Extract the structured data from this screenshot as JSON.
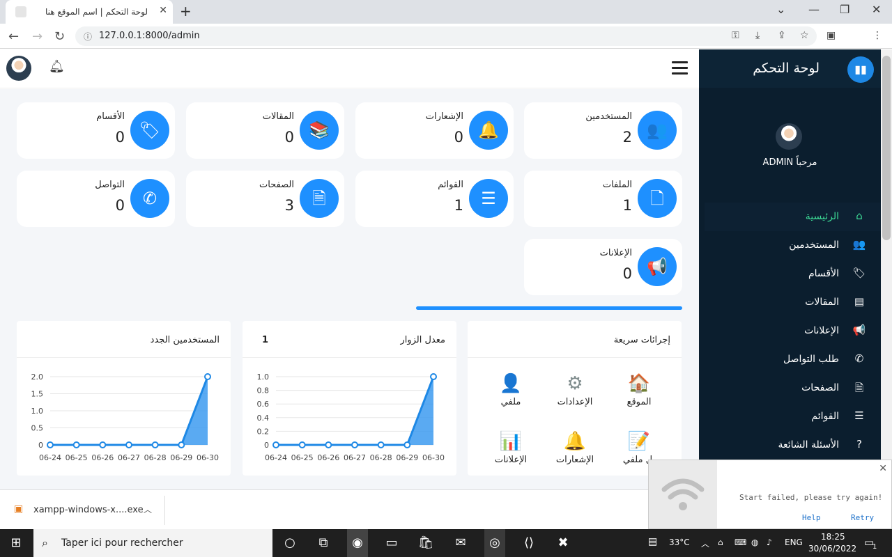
{
  "browser": {
    "tab_title": "لوحة التحكم | اسم الموقع هنا",
    "url": "127.0.0.1:8000/admin"
  },
  "sidebar": {
    "title": "لوحة التحكم",
    "welcome": "مرحباً ADMIN",
    "items": [
      {
        "label": "الرئيسية",
        "icon": "home-icon",
        "glyph": "⌂"
      },
      {
        "label": "المستخدمين",
        "icon": "users-icon",
        "glyph": "👥"
      },
      {
        "label": "الأقسام",
        "icon": "tag-icon",
        "glyph": "🏷"
      },
      {
        "label": "المقالات",
        "icon": "newspaper-icon",
        "glyph": "▤"
      },
      {
        "label": "الإعلانات",
        "icon": "megaphone-icon",
        "glyph": "📢"
      },
      {
        "label": "طلب التواصل",
        "icon": "phone-icon",
        "glyph": "✆"
      },
      {
        "label": "الصفحات",
        "icon": "page-icon",
        "glyph": "🗎"
      },
      {
        "label": "القوائم",
        "icon": "list-icon",
        "glyph": "☰"
      },
      {
        "label": "الأسئلة الشائعة",
        "icon": "question-icon",
        "glyph": "?"
      }
    ]
  },
  "cards": [
    {
      "label": "المستخدمين",
      "value": "2",
      "icon": "users-icon",
      "glyph": "👥"
    },
    {
      "label": "الإشعارات",
      "value": "0",
      "icon": "bell-icon",
      "glyph": "🔔"
    },
    {
      "label": "المقالات",
      "value": "0",
      "icon": "books-icon",
      "glyph": "📚"
    },
    {
      "label": "الأقسام",
      "value": "0",
      "icon": "tag-icon",
      "glyph": "🏷"
    },
    {
      "label": "الملفات",
      "value": "1",
      "icon": "file-icon",
      "glyph": "🗋"
    },
    {
      "label": "القوائم",
      "value": "1",
      "icon": "list-icon",
      "glyph": "☰"
    },
    {
      "label": "الصفحات",
      "value": "3",
      "icon": "page-icon",
      "glyph": "🗎"
    },
    {
      "label": "التواصل",
      "value": "0",
      "icon": "phone-icon",
      "glyph": "✆"
    },
    {
      "label": "الإعلانات",
      "value": "0",
      "icon": "megaphone-icon",
      "glyph": "📢"
    }
  ],
  "quick_actions": {
    "title": "إجرائات سريعة",
    "items": [
      {
        "label": "الموقع",
        "icon": "house-icon",
        "glyph": "🏠"
      },
      {
        "label": "الإعدادات",
        "icon": "gears-icon",
        "glyph": "⚙"
      },
      {
        "label": "ملفي",
        "icon": "profile-icon",
        "glyph": "👤"
      },
      {
        "label": "يل ملفي",
        "icon": "edit-profile-icon",
        "glyph": "📝"
      },
      {
        "label": "الإشعارات",
        "icon": "bell-icon",
        "glyph": "🔔"
      },
      {
        "label": "الإعلانات",
        "icon": "ads-icon",
        "glyph": "📊"
      }
    ]
  },
  "chart_data": [
    {
      "type": "area",
      "title": "معدل الزوار",
      "badge": "1",
      "categories": [
        "06-24",
        "06-25",
        "06-26",
        "06-27",
        "06-28",
        "06-29",
        "06-30"
      ],
      "values": [
        0,
        0,
        0,
        0,
        0,
        0,
        1
      ],
      "ylim": [
        0,
        1
      ],
      "yticks": [
        "1.0",
        "0.8",
        "0.6",
        "0.4",
        "0.2",
        "0"
      ],
      "color": "#3d9bf0"
    },
    {
      "type": "area",
      "title": "المستخدمين الجدد",
      "categories": [
        "06-24",
        "06-25",
        "06-26",
        "06-27",
        "06-28",
        "06-29",
        "06-30"
      ],
      "values": [
        0,
        0,
        0,
        0,
        0,
        0,
        2
      ],
      "ylim": [
        0,
        2
      ],
      "yticks": [
        "2.0",
        "1.5",
        "1.0",
        "0.5",
        "0"
      ],
      "color": "#3d9bf0"
    }
  ],
  "download": {
    "file": "xampp-windows-x....exe"
  },
  "popup": {
    "message": "Start failed, please try again!",
    "help": "Help",
    "retry": "Retry"
  },
  "taskbar": {
    "search": "Taper ici pour rechercher",
    "temp": "33°C",
    "lang": "ENG",
    "time": "18:25",
    "date": "30/06/2022",
    "notif": "1"
  },
  "colors": {
    "accent": "#1e90ff",
    "sidebar": "#0b1e2e",
    "active": "#3ddc97"
  }
}
